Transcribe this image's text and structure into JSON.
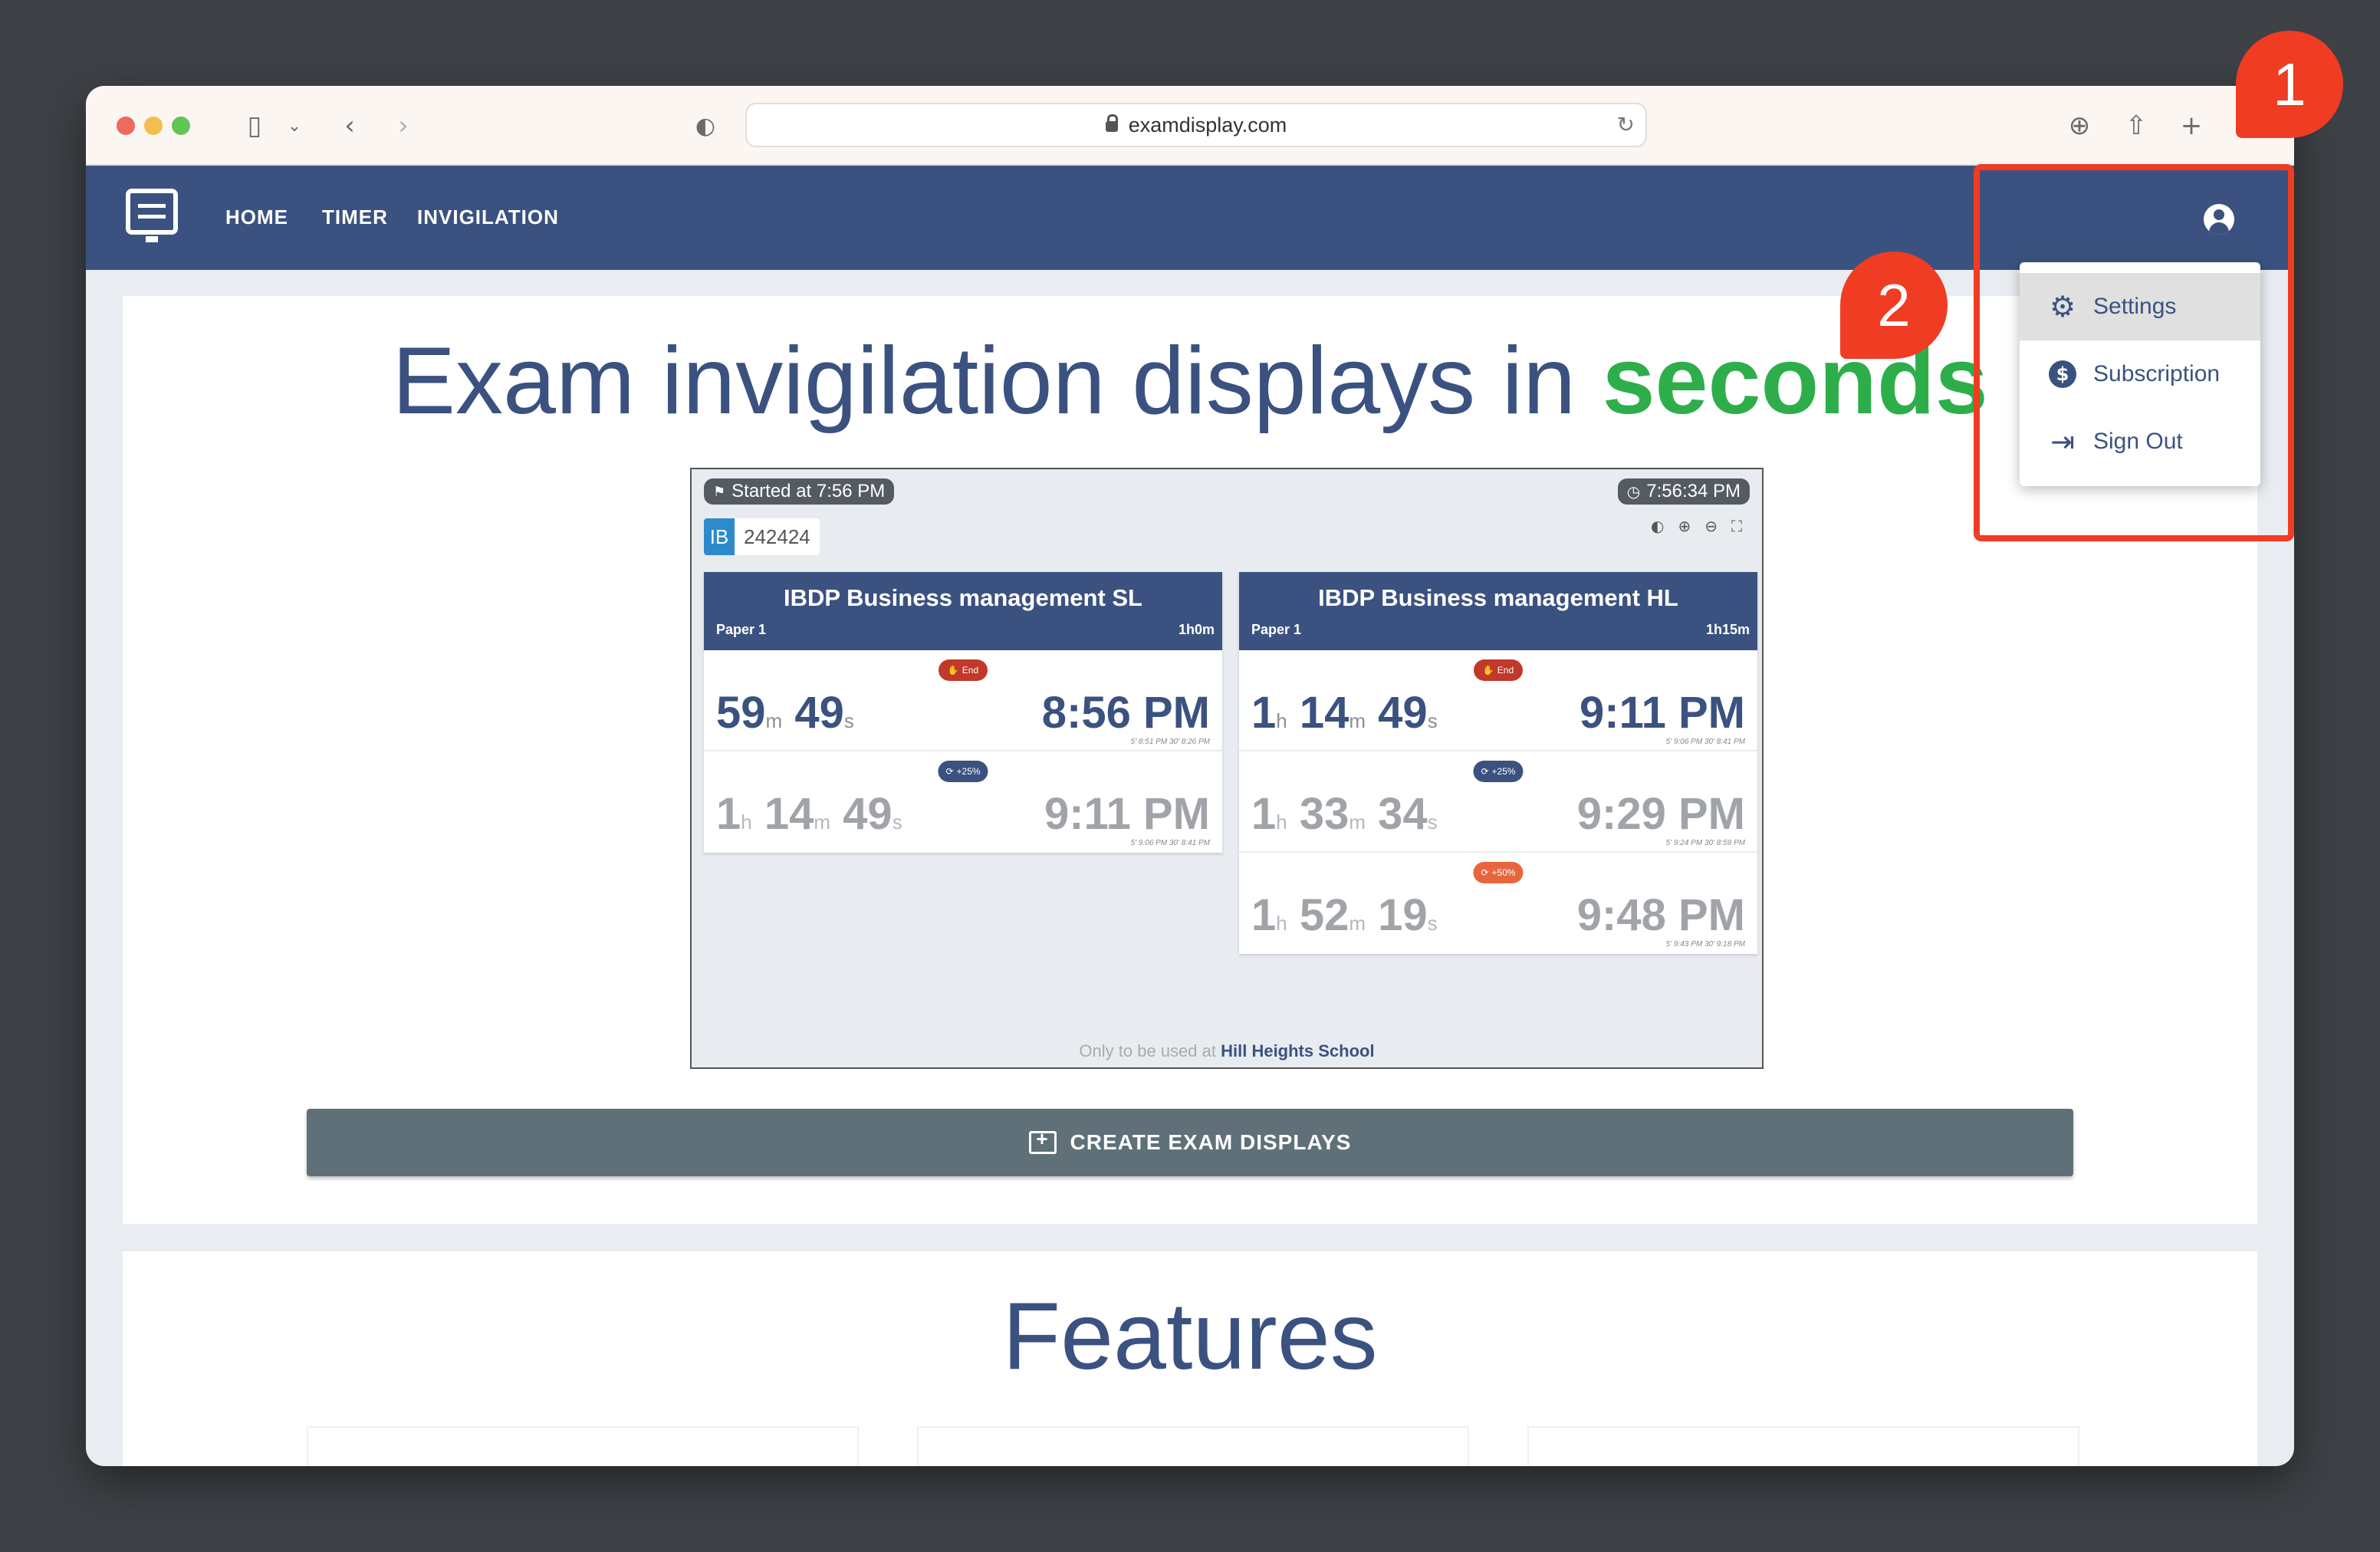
{
  "browser": {
    "url": "examdisplay.com"
  },
  "nav": {
    "links": [
      "HOME",
      "TIMER",
      "INVIGILATION"
    ]
  },
  "user_menu": {
    "items": [
      {
        "label": "Settings",
        "icon": "gear-icon"
      },
      {
        "label": "Subscription",
        "icon": "dollar-icon"
      },
      {
        "label": "Sign Out",
        "icon": "sign-out-icon"
      }
    ]
  },
  "hero": {
    "title_main": "Exam invigilation displays in",
    "title_accent": "seconds"
  },
  "preview": {
    "started": "Started at 7:56 PM",
    "clock": "7:56:34 PM",
    "badge": "IB",
    "code": "242424",
    "footer_prefix": "Only to be used at",
    "school": "Hill Heights School",
    "exams": [
      {
        "title": "IBDP Business management SL",
        "paper": "Paper 1",
        "duration": "1h0m",
        "rows": [
          {
            "tag": "End",
            "h": "",
            "m": "59",
            "s": "49",
            "time": "8:56 PM",
            "sub": "5' 8:51 PM    30' 8:26 PM",
            "style": "dark"
          },
          {
            "tag": "+25%",
            "h": "1",
            "m": "14",
            "s": "49",
            "time": "9:11 PM",
            "sub": "5' 9:06 PM    30' 8:41 PM",
            "style": "grey"
          }
        ]
      },
      {
        "title": "IBDP Business management HL",
        "paper": "Paper 1",
        "duration": "1h15m",
        "rows": [
          {
            "tag": "End",
            "h": "1",
            "m": "14",
            "s": "49",
            "time": "9:11 PM",
            "sub": "5' 9:06 PM    30' 8:41 PM",
            "style": "dark"
          },
          {
            "tag": "+25%",
            "h": "1",
            "m": "33",
            "s": "34",
            "time": "9:29 PM",
            "sub": "5' 9:24 PM    30' 8:59 PM",
            "style": "grey"
          },
          {
            "tag": "+50%",
            "h": "1",
            "m": "52",
            "s": "19",
            "time": "9:48 PM",
            "sub": "5' 9:43 PM    30' 9:18 PM",
            "style": "grey"
          }
        ]
      }
    ]
  },
  "cta": {
    "label": "CREATE EXAM DISPLAYS"
  },
  "features": {
    "title": "Features"
  },
  "callouts": [
    "1",
    "2"
  ],
  "colors": {
    "nav": "#3b5280",
    "accent": "#2eae4a",
    "callout": "#f03c22",
    "tag_end": "#c0392b",
    "tag_extra": "#3b5280",
    "tag_extra50": "#e8663d"
  }
}
